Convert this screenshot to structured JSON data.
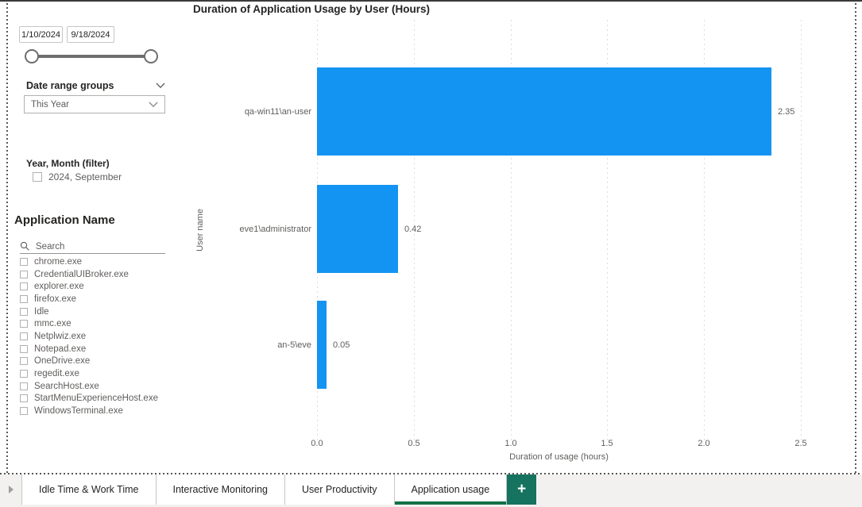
{
  "chart_data": {
    "type": "bar",
    "orientation": "horizontal",
    "title": "Duration of Application Usage by User (Hours)",
    "categories": [
      "qa-win11\\an-user",
      "eve1\\administrator",
      "an-5\\eve"
    ],
    "values": [
      2.35,
      0.42,
      0.05
    ],
    "data_labels": [
      "2.35",
      "0.42",
      "0.05"
    ],
    "xlabel": "Duration of usage (hours)",
    "ylabel": "User name",
    "xlim": [
      0,
      2.5
    ],
    "x_ticks": [
      0,
      0.5,
      1,
      1.5,
      2,
      2.5
    ],
    "x_tick_labels": [
      "0.0",
      "0.5",
      "1.0",
      "1.5",
      "2.0",
      "2.5"
    ],
    "legend": "none",
    "grid": "vertical dotted"
  },
  "slicers": {
    "date_range": {
      "start": "1/10/2024",
      "end": "9/18/2024"
    },
    "date_range_groups": {
      "label": "Date range groups",
      "selected": "This Year"
    },
    "year_month": {
      "label": "Year, Month (filter)",
      "options": [
        {
          "label": "2024, September",
          "checked": false
        }
      ]
    },
    "application_name": {
      "label": "Application Name",
      "search_placeholder": "Search",
      "options": [
        "chrome.exe",
        "CredentialUIBroker.exe",
        "explorer.exe",
        "firefox.exe",
        "Idle",
        "mmc.exe",
        "Netplwiz.exe",
        "Notepad.exe",
        "OneDrive.exe",
        "regedit.exe",
        "SearchHost.exe",
        "StartMenuExperienceHost.exe",
        "WindowsTerminal.exe"
      ]
    }
  },
  "tabs": {
    "items": [
      {
        "label": "Idle Time & Work Time",
        "active": false
      },
      {
        "label": "Interactive Monitoring",
        "active": false
      },
      {
        "label": "User Productivity",
        "active": false
      },
      {
        "label": "Application usage",
        "active": true
      }
    ],
    "add_page_label": "+"
  },
  "colors": {
    "bar": "#1494F2",
    "accent_green": "#15735F",
    "active_tab_underline": "#117245",
    "text_primary": "#252423",
    "text_secondary": "#605E5C"
  }
}
